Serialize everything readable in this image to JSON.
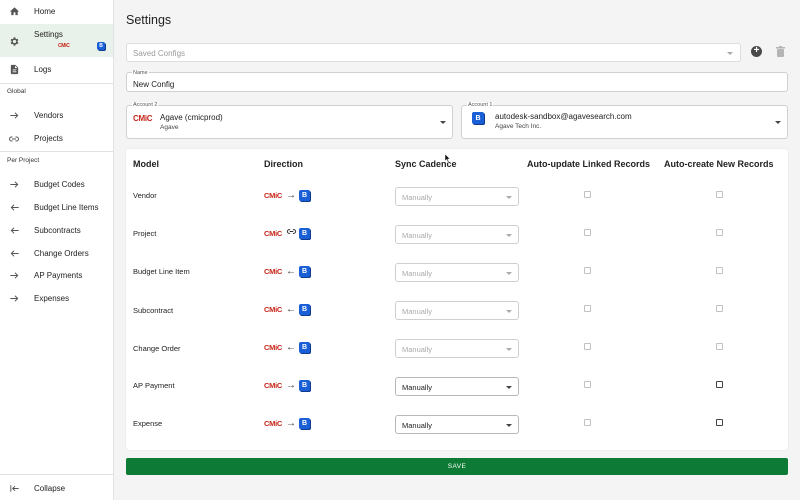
{
  "nav": {
    "home": "Home",
    "settings": "Settings",
    "settings_badge": "CMiC",
    "logs": "Logs",
    "global_section": "Global",
    "vendors": "Vendors",
    "projects": "Projects",
    "per_project_section": "Per Project",
    "budget_codes": "Budget Codes",
    "budget_line_items": "Budget Line Items",
    "subcontracts": "Subcontracts",
    "change_orders": "Change Orders",
    "ap_payments": "AP Payments",
    "expenses": "Expenses",
    "collapse": "Collapse"
  },
  "page": {
    "title": "Settings"
  },
  "saved_configs": {
    "placeholder": "Saved Configs"
  },
  "name_field": {
    "label": "Name",
    "value": "New Config"
  },
  "account2": {
    "label": "Account 2",
    "logo": "CMiC",
    "name": "Agave (cmicprod)",
    "sub": "Agave"
  },
  "account1": {
    "label": "Account 1",
    "name": "autodesk-sandbox@agavesearch.com",
    "sub": "Agave Tech Inc."
  },
  "table": {
    "headers": {
      "model": "Model",
      "direction": "Direction",
      "cadence": "Sync Cadence",
      "auto_update": "Auto-update Linked Records",
      "auto_create": "Auto-create New Records"
    },
    "rows": [
      {
        "model": "Vendor",
        "direction": "→",
        "cadence": "Manually",
        "cadence_enabled": false,
        "auto_update": false,
        "auto_create": false
      },
      {
        "model": "Project",
        "direction": "link",
        "cadence": "Manually",
        "cadence_enabled": false,
        "auto_update": false,
        "auto_create": false
      },
      {
        "model": "Budget Line Item",
        "direction": "←",
        "cadence": "Manually",
        "cadence_enabled": false,
        "auto_update": false,
        "auto_create": false
      },
      {
        "model": "Subcontract",
        "direction": "←",
        "cadence": "Manually",
        "cadence_enabled": false,
        "auto_update": false,
        "auto_create": false
      },
      {
        "model": "Change Order",
        "direction": "←",
        "cadence": "Manually",
        "cadence_enabled": false,
        "auto_update": false,
        "auto_create": false
      },
      {
        "model": "AP Payment",
        "direction": "→",
        "cadence": "Manually",
        "cadence_enabled": true,
        "auto_update": false,
        "auto_create": false
      },
      {
        "model": "Expense",
        "direction": "→",
        "cadence": "Manually",
        "cadence_enabled": true,
        "auto_update": false,
        "auto_create": false
      }
    ],
    "cmic_logo": "CMiC",
    "b_logo": "B"
  },
  "save_button": "SAVE",
  "colors": {
    "accent_green": "#0d7a35",
    "cmic_red": "#c8261c",
    "bbox_blue": "#1a5fd6"
  }
}
